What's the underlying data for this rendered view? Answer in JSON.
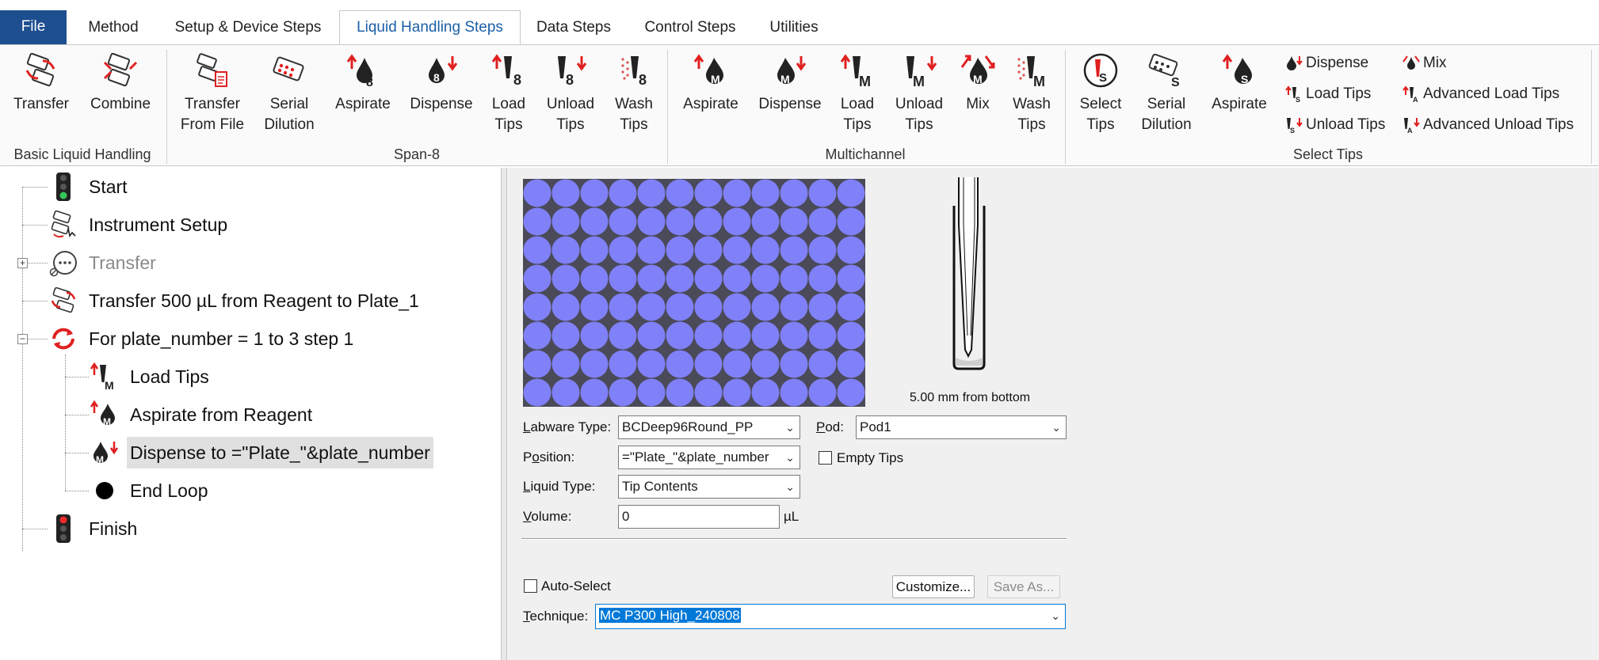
{
  "tabs": {
    "file": "File",
    "method": "Method",
    "setup": "Setup & Device Steps",
    "liquid": "Liquid Handling Steps",
    "data": "Data Steps",
    "control": "Control Steps",
    "utilities": "Utilities"
  },
  "ribbon": {
    "basic": {
      "label": "Basic Liquid Handling",
      "transfer": "Transfer",
      "combine": "Combine"
    },
    "span8": {
      "label": "Span-8",
      "transfer_from_file_1": "Transfer",
      "transfer_from_file_2": "From File",
      "serial_dilution_1": "Serial",
      "serial_dilution_2": "Dilution",
      "aspirate": "Aspirate",
      "dispense": "Dispense",
      "load_tips_1": "Load",
      "load_tips_2": "Tips",
      "unload_tips_1": "Unload",
      "unload_tips_2": "Tips",
      "wash_tips_1": "Wash",
      "wash_tips_2": "Tips"
    },
    "multichannel": {
      "label": "Multichannel",
      "aspirate": "Aspirate",
      "dispense": "Dispense",
      "load_tips_1": "Load",
      "load_tips_2": "Tips",
      "unload_tips_1": "Unload",
      "unload_tips_2": "Tips",
      "mix": "Mix",
      "wash_tips_1": "Wash",
      "wash_tips_2": "Tips"
    },
    "select_tips": {
      "label": "Select Tips",
      "select_tips_1": "Select",
      "select_tips_2": "Tips",
      "serial_dilution_1": "Serial",
      "serial_dilution_2": "Dilution",
      "aspirate": "Aspirate",
      "dispense": "Dispense",
      "load_tips": "Load Tips",
      "unload_tips": "Unload Tips",
      "mix": "Mix",
      "advanced_load_tips": "Advanced Load Tips",
      "advanced_unload_tips": "Advanced Unload Tips"
    }
  },
  "tree": {
    "start": "Start",
    "instrument_setup": "Instrument Setup",
    "transfer": "Transfer",
    "transfer_500": "Transfer 500 µL from Reagent to Plate_1",
    "for_loop": "For plate_number = 1 to 3 step 1",
    "load_tips": "Load Tips",
    "aspirate": "Aspirate from Reagent",
    "dispense": "Dispense to =\"Plate_\"&plate_number",
    "end_loop": "End Loop",
    "finish": "Finish"
  },
  "panel": {
    "tip_caption": "5.00 mm from bottom",
    "labware_type_label": "Labware Type:",
    "labware_type_value": "BCDeep96Round_PP",
    "pod_label": "Pod:",
    "pod_value": "Pod1",
    "position_label": "Position:",
    "position_value": "=\"Plate_\"&plate_number",
    "empty_tips_label": "Empty Tips",
    "liquid_type_label": "Liquid Type:",
    "liquid_type_value": "Tip Contents",
    "volume_label": "Volume:",
    "volume_value": "0",
    "volume_unit": "µL",
    "auto_select_label": "Auto-Select",
    "customize_button": "Customize...",
    "save_as_button": "Save As...",
    "technique_label": "Technique:",
    "technique_value": "MC P300 High_240808"
  },
  "colors": {
    "file_tab": "#1d4e8f",
    "active_tab_text": "#1c5fa8",
    "well_fill": "#8080f8",
    "plate_bg": "#4a4a58",
    "icon_red": "#e02020",
    "selection": "#e0e0e0",
    "technique_highlight": "#0078d7"
  }
}
